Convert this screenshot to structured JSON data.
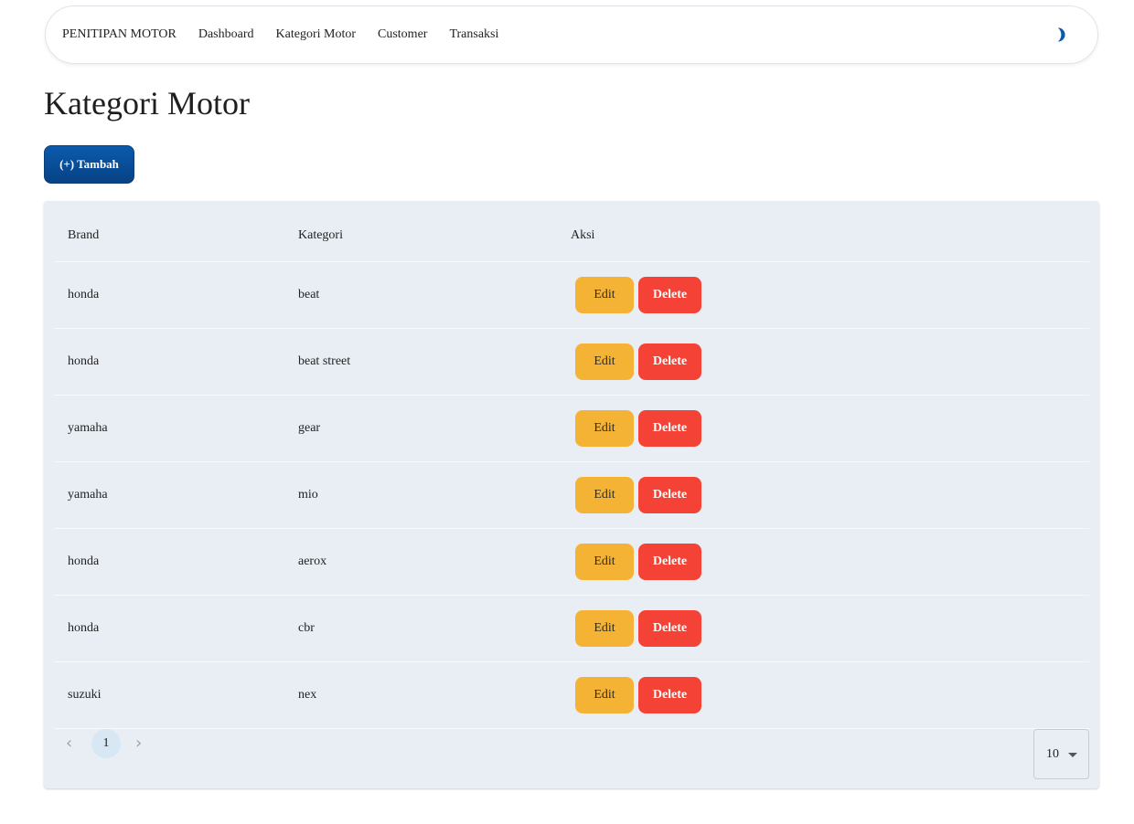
{
  "navbar": {
    "brand": "PENITIPAN MOTOR",
    "links": [
      "Dashboard",
      "Kategori Motor",
      "Customer",
      "Transaksi"
    ],
    "theme_icon": "half-moon-icon",
    "theme_icon_color": "#0b5aad"
  },
  "page": {
    "title": "Kategori Motor",
    "add_button_label": "(+) Tambah"
  },
  "table": {
    "columns": [
      "Brand",
      "Kategori",
      "Aksi"
    ],
    "rows": [
      {
        "brand": "honda",
        "kategori": "beat",
        "edit": "Edit",
        "delete": "Delete"
      },
      {
        "brand": "honda",
        "kategori": "beat street",
        "edit": "Edit",
        "delete": "Delete"
      },
      {
        "brand": "yamaha",
        "kategori": "gear",
        "edit": "Edit",
        "delete": "Delete"
      },
      {
        "brand": "yamaha",
        "kategori": "mio",
        "edit": "Edit",
        "delete": "Delete"
      },
      {
        "brand": "honda",
        "kategori": "aerox",
        "edit": "Edit",
        "delete": "Delete"
      },
      {
        "brand": "honda",
        "kategori": "cbr",
        "edit": "Edit",
        "delete": "Delete"
      },
      {
        "brand": "suzuki",
        "kategori": "nex",
        "edit": "Edit",
        "delete": "Delete"
      }
    ]
  },
  "pagination": {
    "prev": "‹",
    "current_page": "1",
    "next": "›",
    "per_page": "10"
  },
  "colors": {
    "primary": "#0b5aad",
    "edit": "#f5b335",
    "delete": "#f44336",
    "card_bg": "#e9eef5",
    "active_page": "#d7e7f4"
  }
}
